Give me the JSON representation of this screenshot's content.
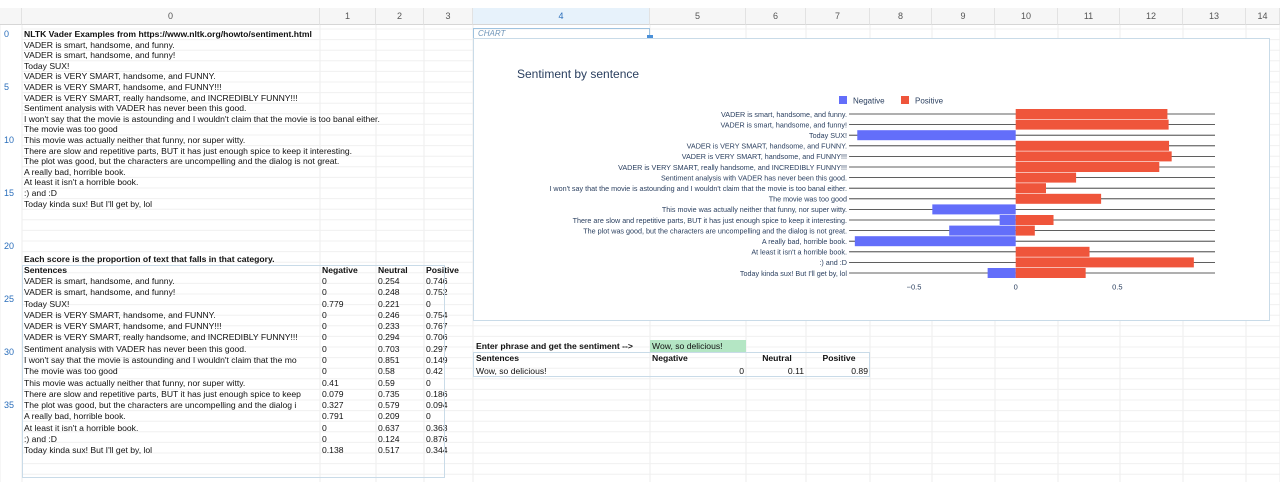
{
  "columns": [
    "0",
    "1",
    "2",
    "3",
    "4",
    "5",
    "6",
    "7",
    "8",
    "9",
    "10",
    "11",
    "12",
    "13",
    "14"
  ],
  "row_labels": [
    "0",
    "5",
    "10",
    "15",
    "20",
    "25",
    "30",
    "35"
  ],
  "title_cell": "NLTK Vader Examples from https://www.nltk.org/howto/sentiment.html",
  "examples": [
    "VADER is smart, handsome, and funny.",
    "VADER is smart, handsome, and funny!",
    "Today SUX!",
    "VADER is VERY SMART, handsome, and FUNNY.",
    "VADER is VERY SMART, handsome, and FUNNY!!!",
    "VADER is VERY SMART, really handsome, and INCREDIBLY FUNNY!!!",
    "Sentiment analysis with VADER has never been this good.",
    "I won't say that the movie is astounding and I wouldn't claim that the movie is too banal either.",
    "The movie was too good",
    "This movie was actually neither that funny, nor super witty.",
    "There are slow and repetitive parts, BUT it has just enough spice to keep it interesting.",
    "The plot was good, but the characters are uncompelling and the dialog is not great.",
    "A really bad, horrible book.",
    "At least it isn't a horrible book.",
    ":) and :D",
    "Today kinda sux! But I'll get by, lol"
  ],
  "score_note": "Each score is the proportion of text that falls in that category.",
  "score_table": {
    "headers": [
      "Sentences",
      "Negative",
      "Neutral",
      "Positive"
    ],
    "rows": [
      [
        "VADER is smart, handsome, and funny.",
        "0",
        "0.254",
        "0.746"
      ],
      [
        "VADER is smart, handsome, and funny!",
        "0",
        "0.248",
        "0.752"
      ],
      [
        "Today SUX!",
        "0.779",
        "0.221",
        "0"
      ],
      [
        "VADER is VERY SMART, handsome, and FUNNY.",
        "0",
        "0.246",
        "0.754"
      ],
      [
        "VADER is VERY SMART, handsome, and FUNNY!!!",
        "0",
        "0.233",
        "0.767"
      ],
      [
        "VADER is VERY SMART, really handsome, and INCREDIBLY FUNNY!!!",
        "0",
        "0.294",
        "0.706"
      ],
      [
        "Sentiment analysis with VADER has never been this good.",
        "0",
        "0.703",
        "0.297"
      ],
      [
        "I won't say that the movie is astounding and I wouldn't claim that the mo",
        "0",
        "0.851",
        "0.149"
      ],
      [
        "The movie was too good",
        "0",
        "0.58",
        "0.42"
      ],
      [
        "This movie was actually neither that funny, nor super witty.",
        "0.41",
        "0.59",
        "0"
      ],
      [
        "There are slow and repetitive parts, BUT it has just enough spice to keep",
        "0.079",
        "0.735",
        "0.186"
      ],
      [
        "The plot was good, but the characters are uncompelling and the dialog i",
        "0.327",
        "0.579",
        "0.094"
      ],
      [
        "A really bad, horrible book.",
        "0.791",
        "0.209",
        "0"
      ],
      [
        "At least it isn't a horrible book.",
        "0",
        "0.637",
        "0.363"
      ],
      [
        ":) and :D",
        "0",
        "0.124",
        "0.876"
      ],
      [
        "Today kinda sux! But I'll get by, lol",
        "0.138",
        "0.517",
        "0.344"
      ]
    ]
  },
  "chart_tab_label": "CHART",
  "chart_data": {
    "type": "bar",
    "orientation": "horizontal",
    "title": "Sentiment by sentence",
    "legend_position": "top",
    "categories": [
      "VADER is smart, handsome, and funny.",
      "VADER is smart, handsome, and funny!",
      "Today SUX!",
      "VADER is VERY SMART, handsome, and FUNNY.",
      "VADER is VERY SMART, handsome, and FUNNY!!!",
      "VADER is VERY SMART, really handsome, and INCREDIBLY FUNNY!!!",
      "Sentiment analysis with VADER has never been this good.",
      "I won't say that the movie is astounding and I wouldn't claim that the movie is too banal either.",
      "The movie was too good",
      "This movie was actually neither that funny, nor super witty.",
      "There are slow and repetitive parts, BUT it has just enough spice to keep it interesting.",
      "The plot was good, but the characters are uncompelling and the dialog is not great.",
      "A really bad, horrible book.",
      "At least it isn't a horrible book.",
      ":) and :D",
      "Today kinda sux! But I'll get by, lol"
    ],
    "series": [
      {
        "name": "Negative",
        "color": "#636efa",
        "values": [
          0,
          0,
          -0.779,
          0,
          0,
          0,
          0,
          0,
          0,
          -0.41,
          -0.079,
          -0.327,
          -0.791,
          0,
          0,
          -0.138
        ]
      },
      {
        "name": "Positive",
        "color": "#ef553b",
        "values": [
          0.746,
          0.752,
          0,
          0.754,
          0.767,
          0.706,
          0.297,
          0.149,
          0.42,
          0,
          0.186,
          0.094,
          0,
          0.363,
          0.876,
          0.344
        ]
      }
    ],
    "xlim": [
      -0.8,
      0.98
    ],
    "xticks": [
      -0.5,
      0,
      0.5
    ],
    "xtick_labels": [
      "−0.5",
      "0",
      "0.5"
    ]
  },
  "input_prompt": "Enter phrase and get the sentiment -->",
  "input_value": "Wow, so delicious!",
  "result_table": {
    "headers": [
      "Sentences",
      "Negative",
      "Neutral",
      "Positive"
    ],
    "row": [
      "Wow, so delicious!",
      "0",
      "0.11",
      "0.89"
    ]
  }
}
